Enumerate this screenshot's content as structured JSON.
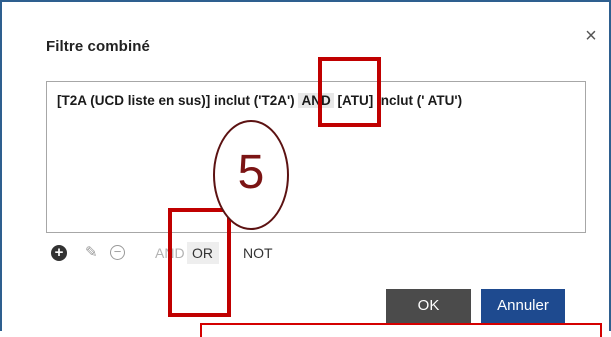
{
  "dialog": {
    "title": "Filtre combiné",
    "close_glyph": "×",
    "expression": {
      "part1": "[T2A (UCD liste en sus)] inclut ('T2A')",
      "operator": "AND",
      "part2": "[ATU] inclut (' ATU')"
    },
    "toolbar": {
      "add_icon": "plus-circle-icon",
      "add_glyph": "+",
      "edit_icon": "pencil-icon",
      "edit_glyph": "✎",
      "remove_icon": "minus-circle-icon",
      "remove_glyph": "−",
      "and_label": "AND",
      "or_label": "OR",
      "not_label": "NOT"
    },
    "buttons": {
      "ok_label": "OK",
      "cancel_label": "Annuler"
    }
  },
  "annotations": {
    "step_number": "5",
    "highlight_color": "#c00000"
  }
}
